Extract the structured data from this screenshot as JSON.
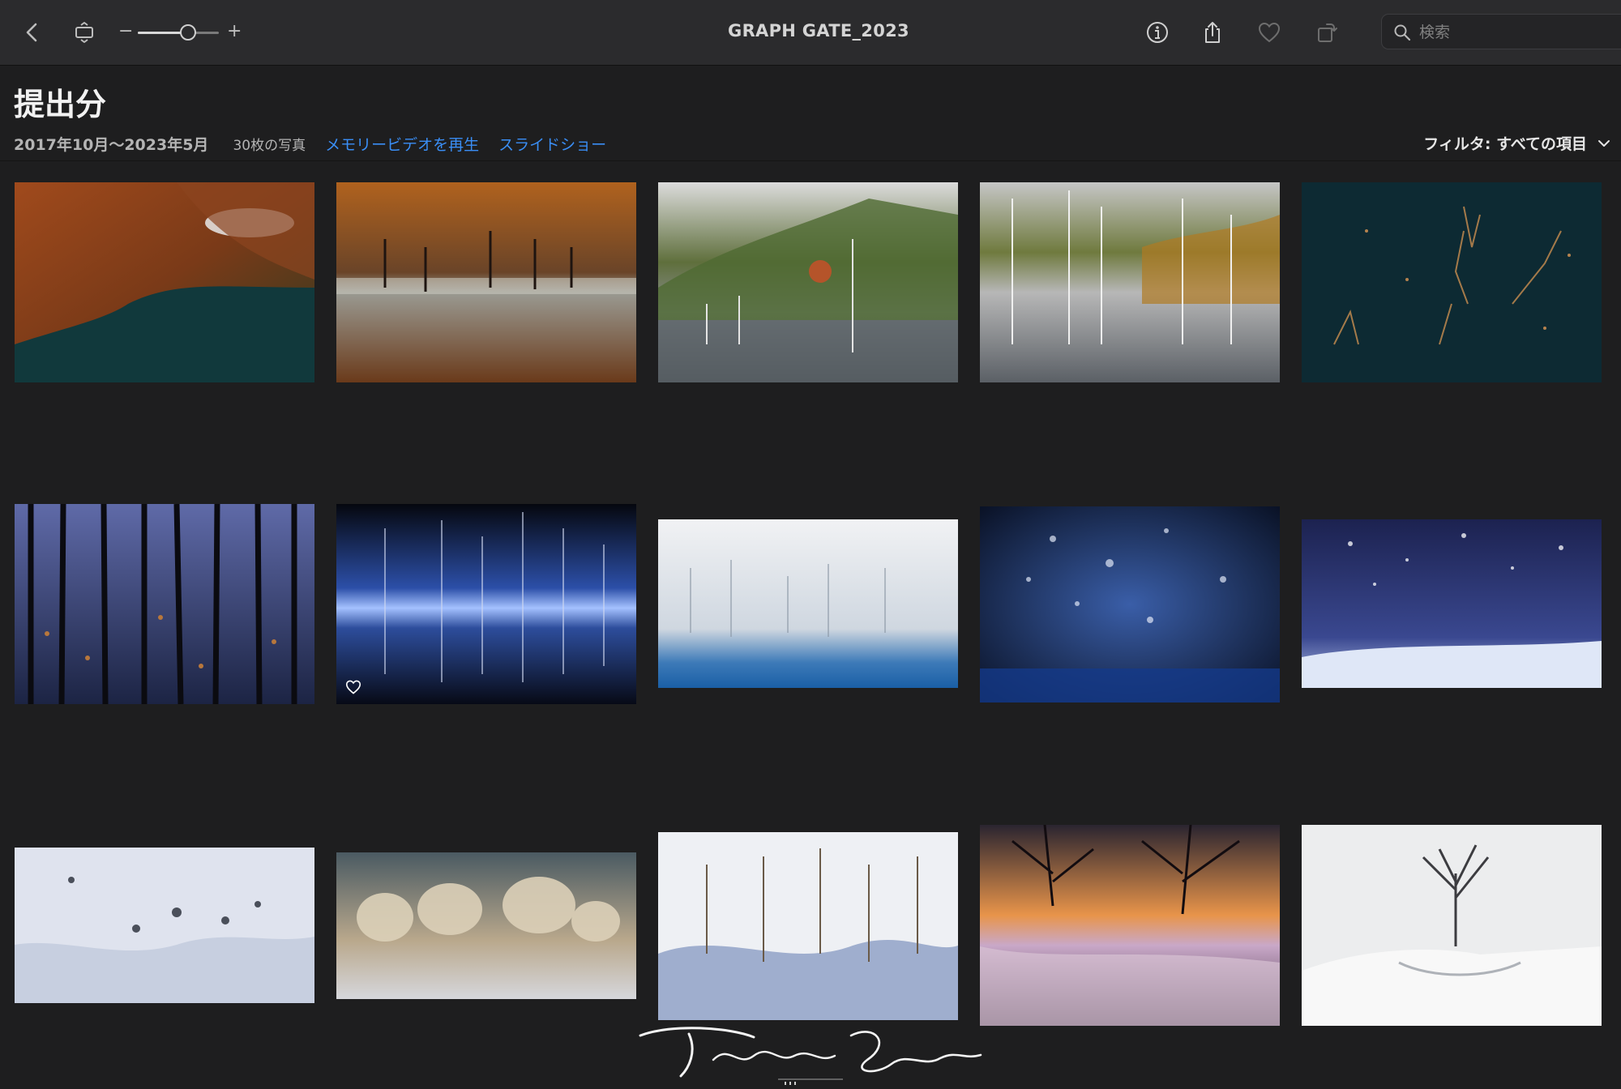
{
  "toolbar": {
    "window_title": "GRAPH GATE_2023",
    "zoom_minus": "−",
    "zoom_plus": "+",
    "zoom_level": 0.62,
    "search_placeholder": "検索",
    "icons": [
      "back-icon",
      "slideshow-frame-icon",
      "info-icon",
      "share-icon",
      "heart-icon",
      "rotate-icon",
      "search-icon"
    ]
  },
  "album": {
    "title": "提出分",
    "date_range": "2017年10月〜2023年5月",
    "photo_count": "30枚の写真",
    "memory_video": "メモリービデオを再生",
    "slideshow": "スライドショー",
    "filter": "フィルタ: すべての項目"
  },
  "colors": {
    "accent": "#3a8ef5",
    "background": "#1e1e1f",
    "toolbar": "#2b2b2d"
  },
  "signature": {
    "name": "Takahiro Gamou",
    "tag": "PHOTOGRAPHY"
  }
}
